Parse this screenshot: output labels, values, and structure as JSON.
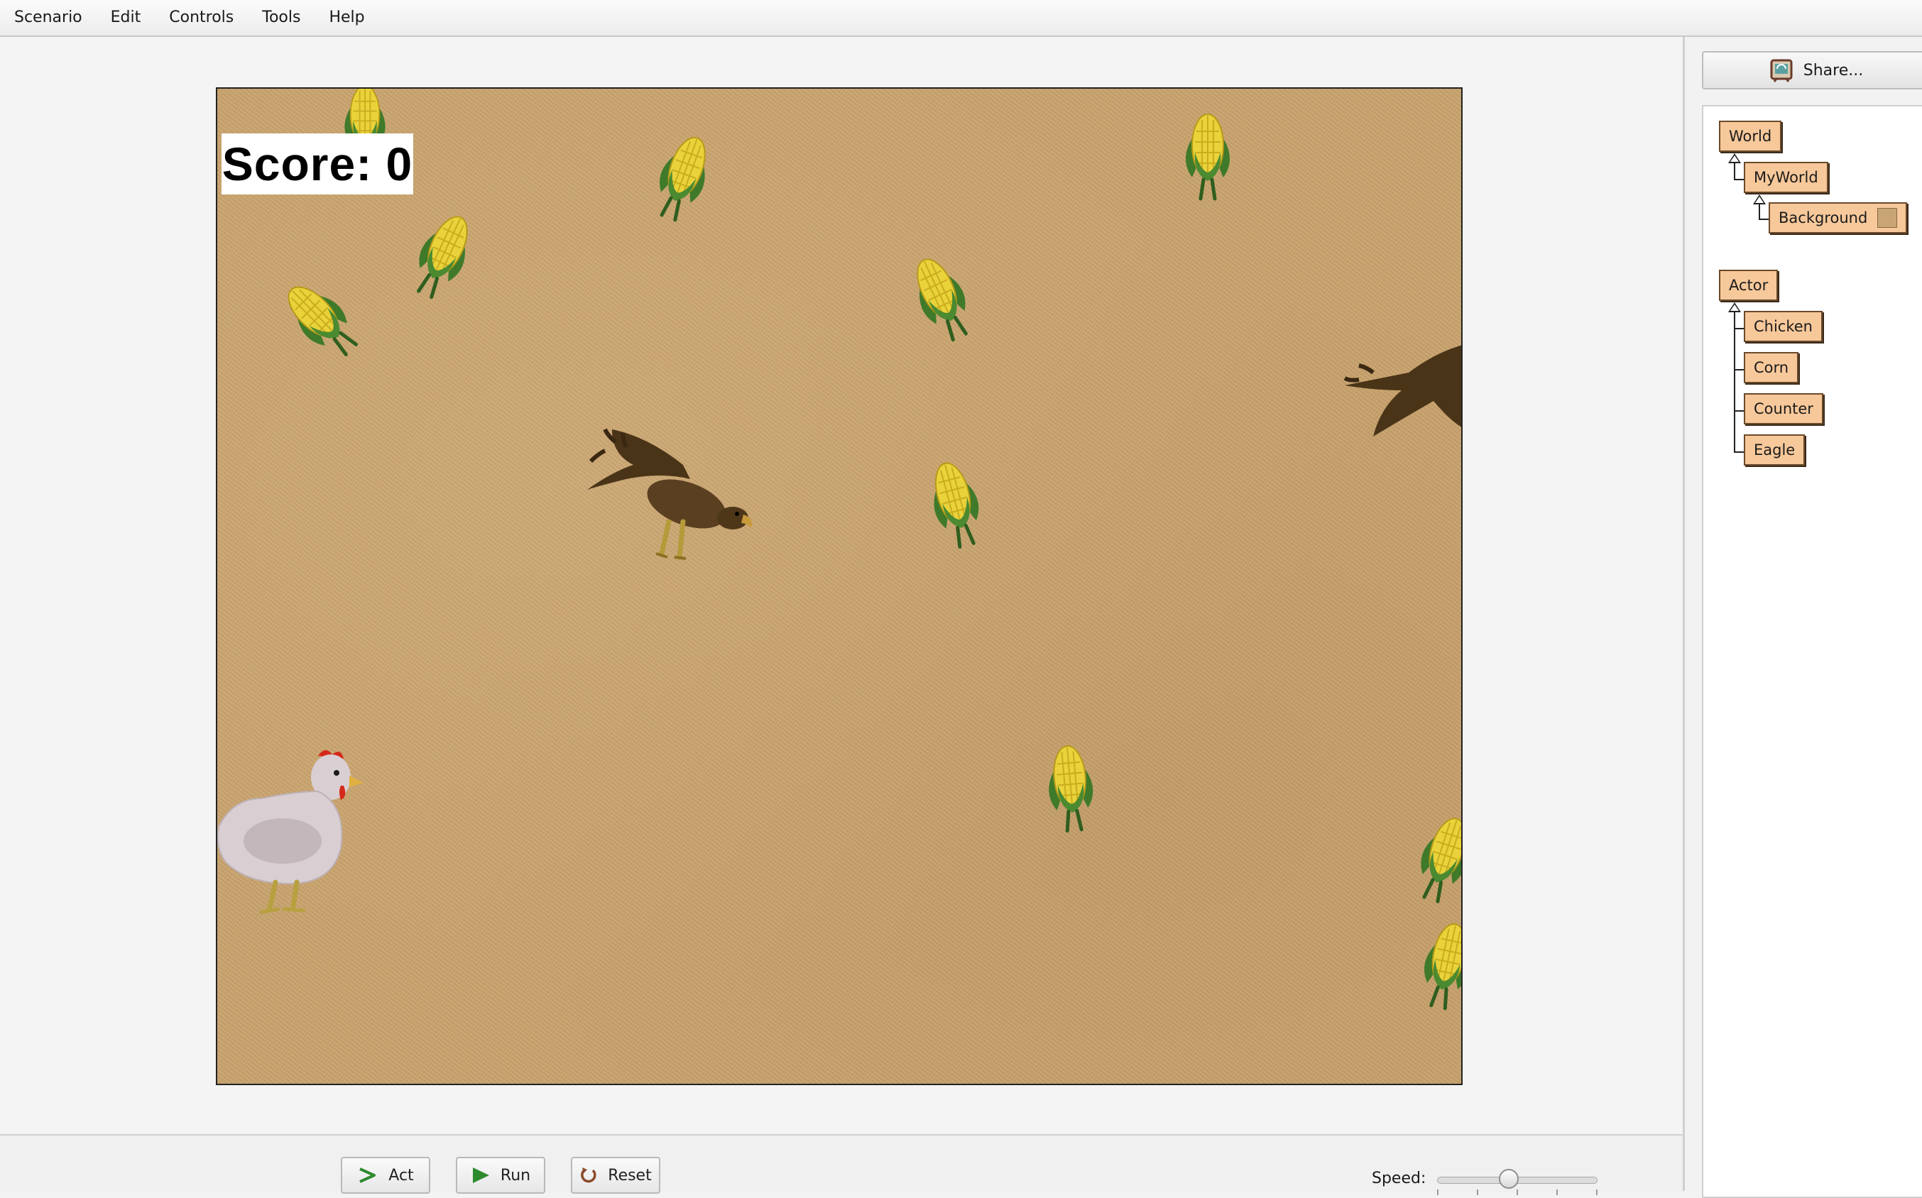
{
  "menubar": {
    "items": [
      {
        "label": "Scenario"
      },
      {
        "label": "Edit"
      },
      {
        "label": "Controls"
      },
      {
        "label": "Tools"
      },
      {
        "label": "Help"
      }
    ]
  },
  "world": {
    "score_text": "Score: 0",
    "background_color": "#c7a16b"
  },
  "controls": {
    "act_label": "Act",
    "run_label": "Run",
    "reset_label": "Reset",
    "speed_label": "Speed:",
    "speed_fraction": 0.45
  },
  "side_panel": {
    "share_label": "Share...",
    "world_classes": {
      "root": "World",
      "child": "MyWorld",
      "grandchild": "Background"
    },
    "actor_classes": {
      "root": "Actor",
      "children": [
        "Chicken",
        "Corn",
        "Counter",
        "Eagle"
      ]
    },
    "class_color": "#f7c89a"
  }
}
